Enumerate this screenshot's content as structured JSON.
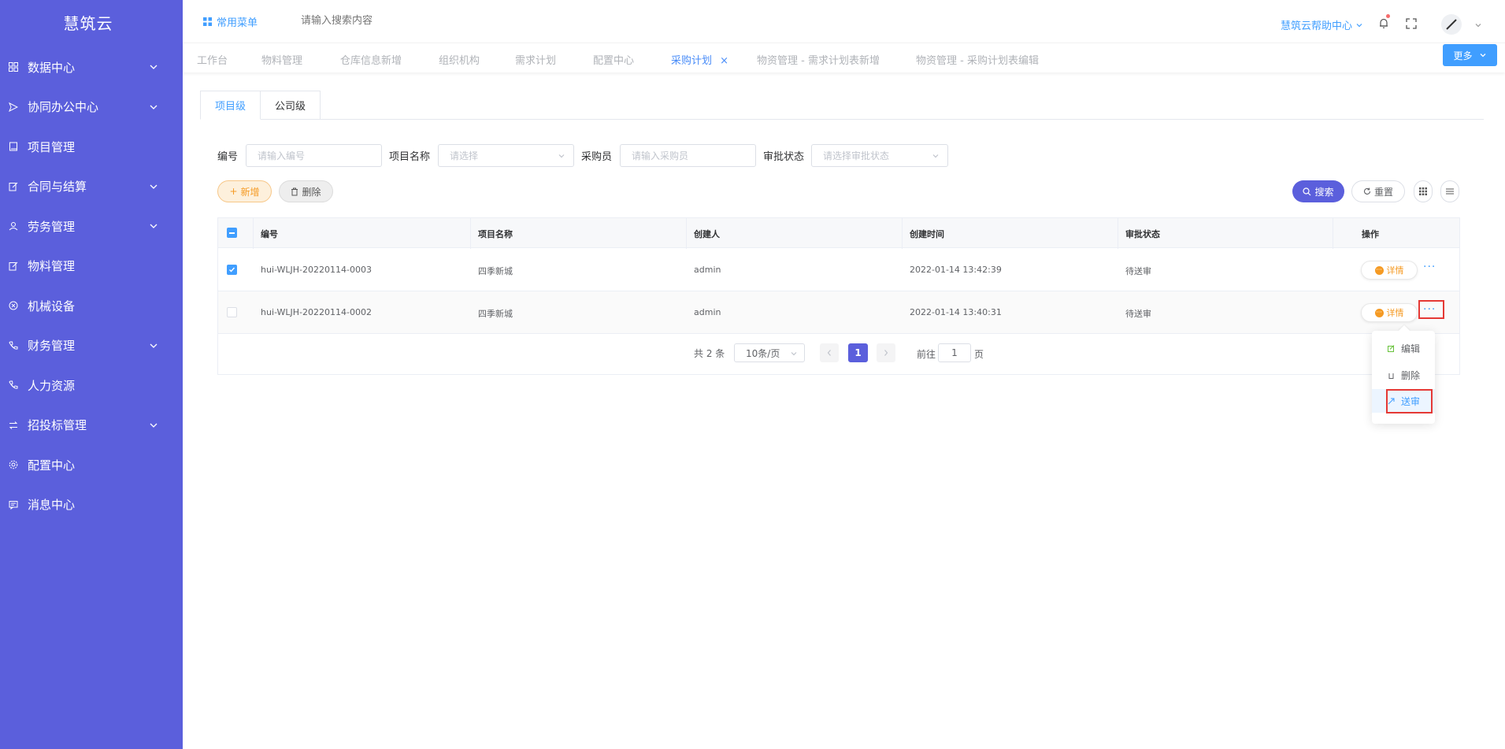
{
  "app": {
    "brand": "慧筑云"
  },
  "sidebar": {
    "items": [
      {
        "label": "数据中心",
        "icon": "grid-icon",
        "has_arrow": true
      },
      {
        "label": "协同办公中心",
        "icon": "send-icon",
        "has_arrow": true
      },
      {
        "label": "项目管理",
        "icon": "book-icon",
        "has_arrow": false
      },
      {
        "label": "合同与结算",
        "icon": "edit-doc-icon",
        "has_arrow": true
      },
      {
        "label": "劳务管理",
        "icon": "worker-icon",
        "has_arrow": true
      },
      {
        "label": "物料管理",
        "icon": "edit-doc-icon",
        "has_arrow": false
      },
      {
        "label": "机械设备",
        "icon": "cross-circle-icon",
        "has_arrow": false
      },
      {
        "label": "财务管理",
        "icon": "phone-icon",
        "has_arrow": true
      },
      {
        "label": "人力资源",
        "icon": "phone-icon",
        "has_arrow": false
      },
      {
        "label": "招投标管理",
        "icon": "swap-icon",
        "has_arrow": true
      },
      {
        "label": "配置中心",
        "icon": "gear-icon",
        "has_arrow": false
      },
      {
        "label": "消息中心",
        "icon": "message-icon",
        "has_arrow": false
      }
    ]
  },
  "header": {
    "common_menu": "常用菜单",
    "search_placeholder": "请输入搜索内容",
    "help_center": "慧筑云帮助中心"
  },
  "tabs": [
    {
      "label": "工作台",
      "active": false
    },
    {
      "label": "物料管理",
      "active": false
    },
    {
      "label": "仓库信息新增",
      "active": false
    },
    {
      "label": "组织机构",
      "active": false
    },
    {
      "label": "需求计划",
      "active": false
    },
    {
      "label": "配置中心",
      "active": false
    },
    {
      "label": "采购计划",
      "active": true
    },
    {
      "label": "物资管理 - 需求计划表新增",
      "active": false
    },
    {
      "label": "物资管理 - 采购计划表编辑",
      "active": false
    }
  ],
  "more_button": "更多",
  "subtabs": [
    "项目级",
    "公司级"
  ],
  "filters": {
    "code_label": "编号",
    "code_placeholder": "请输入编号",
    "project_label": "项目名称",
    "project_placeholder": "请选择",
    "buyer_label": "采购员",
    "buyer_placeholder": "请输入采购员",
    "status_label": "审批状态",
    "status_placeholder": "请选择审批状态"
  },
  "actions": {
    "add": "新增",
    "delete": "删除",
    "search": "搜索",
    "reset": "重置"
  },
  "table": {
    "headers": [
      "编号",
      "项目名称",
      "创建人",
      "创建时间",
      "审批状态",
      "操作"
    ],
    "rows": [
      {
        "code": "hui-WLJH-20220114-0003",
        "project": "四季新城",
        "creator": "admin",
        "created": "2022-01-14 13:42:39",
        "status": "待送审",
        "detail": "详情",
        "checked": true
      },
      {
        "code": "hui-WLJH-20220114-0002",
        "project": "四季新城",
        "creator": "admin",
        "created": "2022-01-14 13:40:31",
        "status": "待送审",
        "detail": "详情",
        "checked": false
      }
    ]
  },
  "pagination": {
    "total": "共 2 条",
    "page_size": "10条/页",
    "current": "1",
    "goto_prefix": "前往",
    "goto_value": "1",
    "goto_suffix": "页"
  },
  "row_menu": {
    "items": [
      "编辑",
      "删除",
      "送审"
    ]
  },
  "colors": {
    "sidebar": "#5b5fdc",
    "accent": "#409eff",
    "search_btn": "#5b5fdc",
    "detail": "#f59a23",
    "highlight": "#e53935"
  }
}
